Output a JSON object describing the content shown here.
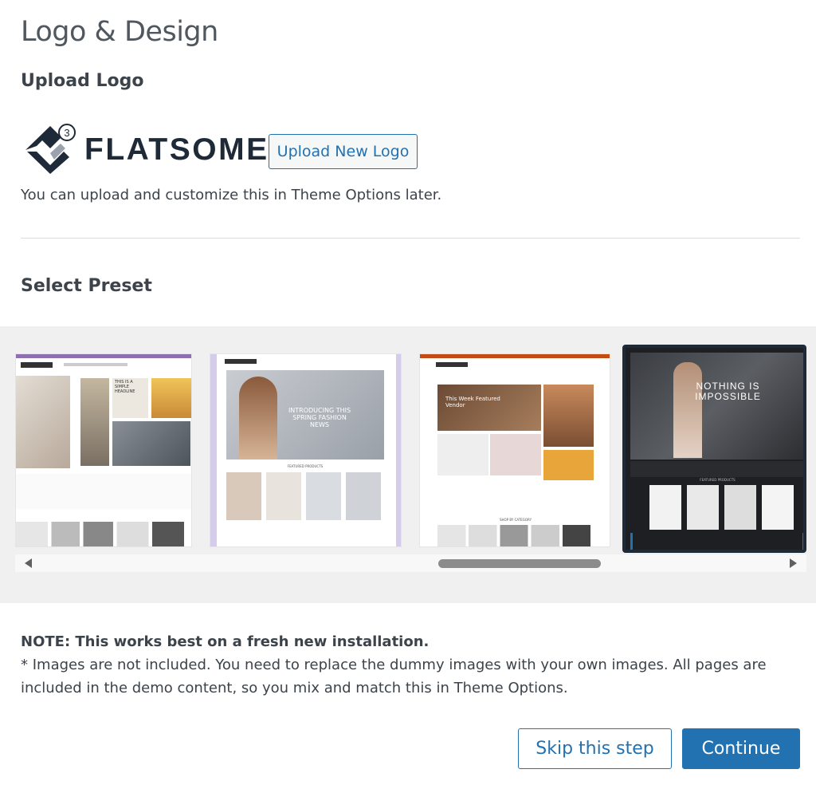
{
  "page": {
    "title": "Logo & Design"
  },
  "upload": {
    "heading": "Upload Logo",
    "logo_text": "FLATSOME",
    "logo_badge": "3",
    "button_label": "Upload New Logo",
    "hint": "You can upload and customize this in Theme Options later."
  },
  "presets": {
    "heading": "Select Preset",
    "items": [
      {
        "headline": "THIS IS A SIMPLE HEADLINE",
        "selected": false
      },
      {
        "headline": "INTRODUCING THIS SPRING FASHION NEWS",
        "section": "FEATURED PRODUCTS",
        "selected": false
      },
      {
        "headline": "This Week Featured Vendor",
        "section": "SHOP BY CATEGORY",
        "selected": false
      },
      {
        "headline": "NOTHING IS IMPOSSIBLE",
        "section": "FEATURED PRODUCTS",
        "selected": true
      }
    ],
    "accent": "#1f2a38"
  },
  "note": {
    "bold": "NOTE: This works best on a fresh new installation.",
    "text": "* Images are not included. You need to replace the dummy images with your own images. All pages are included in the demo content, so you mix and match this in Theme Options."
  },
  "actions": {
    "skip_label": "Skip this step",
    "continue_label": "Continue"
  },
  "colors": {
    "primary": "#2271b1",
    "text": "#3c434a"
  }
}
